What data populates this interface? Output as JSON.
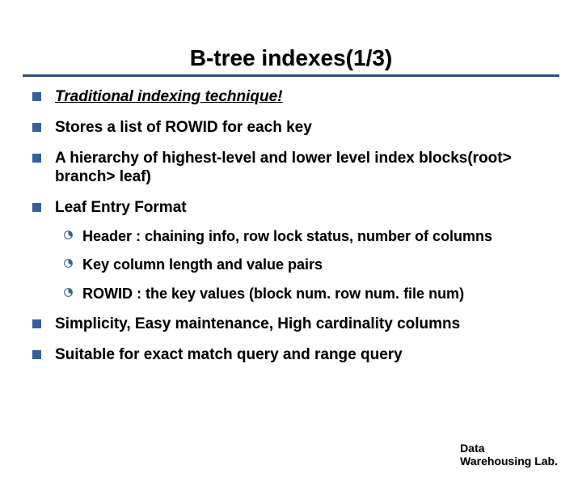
{
  "title": "B-tree indexes(1/3)",
  "bullets": {
    "b1": "Traditional indexing technique!",
    "b2": "Stores a list of ROWID for each key",
    "b3": "A hierarchy of highest-level and lower level index blocks(root> branch> leaf)",
    "b4": "Leaf Entry Format",
    "b4_sub": {
      "s1": "Header : chaining info, row lock status, number of columns",
      "s2": "Key column length and value pairs",
      "s3": "ROWID : the key values (block num. row num. file num)"
    },
    "b5": "Simplicity, Easy maintenance, High cardinality columns",
    "b6": "Suitable for exact match query and range query"
  },
  "footer": {
    "line1": "Data",
    "line2": "Warehousing Lab."
  }
}
